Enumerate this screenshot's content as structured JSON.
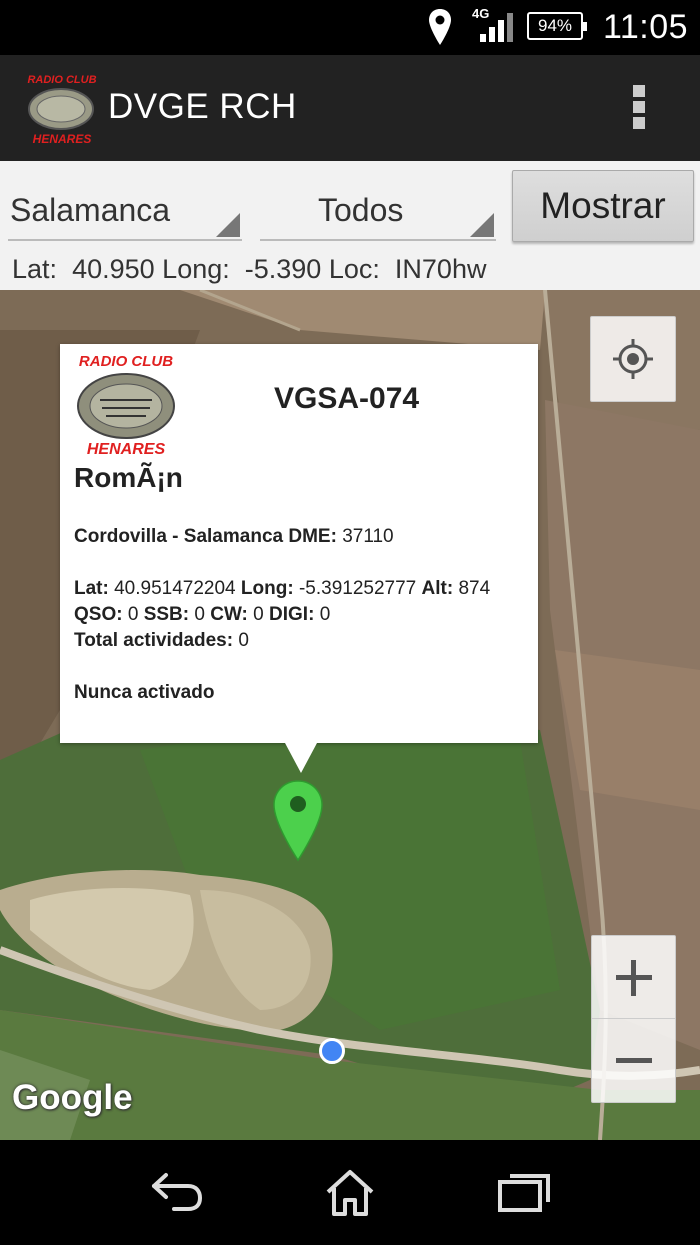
{
  "status_bar": {
    "network": "4G",
    "battery": "94%",
    "time": "11:05",
    "icons": [
      "location-icon",
      "signal-icon",
      "battery-icon"
    ]
  },
  "app_bar": {
    "title": "DVGE RCH",
    "logo_text_top": "RADIO CLUB",
    "logo_text_bottom": "HENARES",
    "menu_icon": "overflow-menu-icon"
  },
  "controls": {
    "region_value": "Salamanca",
    "type_value": "Todos",
    "show_button": "Mostrar",
    "lat_label": "Lat:",
    "lat_value": "40.950",
    "long_label": "Long:",
    "long_value": "-5.390",
    "loc_label": "Loc:",
    "loc_value": "IN70hw"
  },
  "map": {
    "attribution": "Google",
    "my_location_icon": "my-location-icon",
    "zoom_in": "+",
    "zoom_out": "−",
    "marker_color": "#4cd04c",
    "user_dot_color": "#4285f4"
  },
  "info_window": {
    "logo_text_top": "RADIO CLUB",
    "logo_text_bottom": "HENARES",
    "code": "VGSA-074",
    "name": "RomÃ¡n",
    "location_label": "Cordovilla - Salamanca DME:",
    "location_value": "37110",
    "lat_label": "Lat:",
    "lat_value": "40.951472204",
    "long_label": "Long:",
    "long_value": "-5.391252777",
    "alt_label": "Alt:",
    "alt_value": "874",
    "qso_label": "QSO:",
    "qso_value": "0",
    "ssb_label": "SSB:",
    "ssb_value": "0",
    "cw_label": "CW:",
    "cw_value": "0",
    "digi_label": "DIGI:",
    "digi_value": "0",
    "total_label": "Total actividades:",
    "total_value": "0",
    "status": "Nunca activado"
  },
  "nav_bar": {
    "icons": [
      "back-icon",
      "home-icon",
      "recents-icon"
    ]
  }
}
